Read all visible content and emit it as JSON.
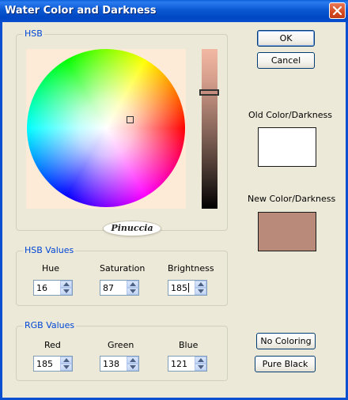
{
  "window": {
    "title": "Water Color and Darkness"
  },
  "buttons": {
    "ok": "OK",
    "cancel": "Cancel",
    "no_coloring": "No Coloring",
    "pure_black": "Pure Black"
  },
  "hsb_group": {
    "label": "HSB",
    "logo_text": "Pinuccia"
  },
  "hsb_values": {
    "label": "HSB Values",
    "hue_label": "Hue",
    "hue": "16",
    "saturation_label": "Saturation",
    "saturation": "87",
    "brightness_label": "Brightness",
    "brightness": "185"
  },
  "rgb_values": {
    "label": "RGB Values",
    "red_label": "Red",
    "red": "185",
    "green_label": "Green",
    "green": "138",
    "blue_label": "Blue",
    "blue": "121"
  },
  "swatches": {
    "old_label": "Old Color/Darkness",
    "old_color": "#ffffff",
    "new_label": "New Color/Darkness",
    "new_color": "#b98a79"
  },
  "colors": {
    "titlebar": "#0a58d2",
    "group_label": "#0046d5",
    "dialog_bg": "#ece9d8"
  }
}
